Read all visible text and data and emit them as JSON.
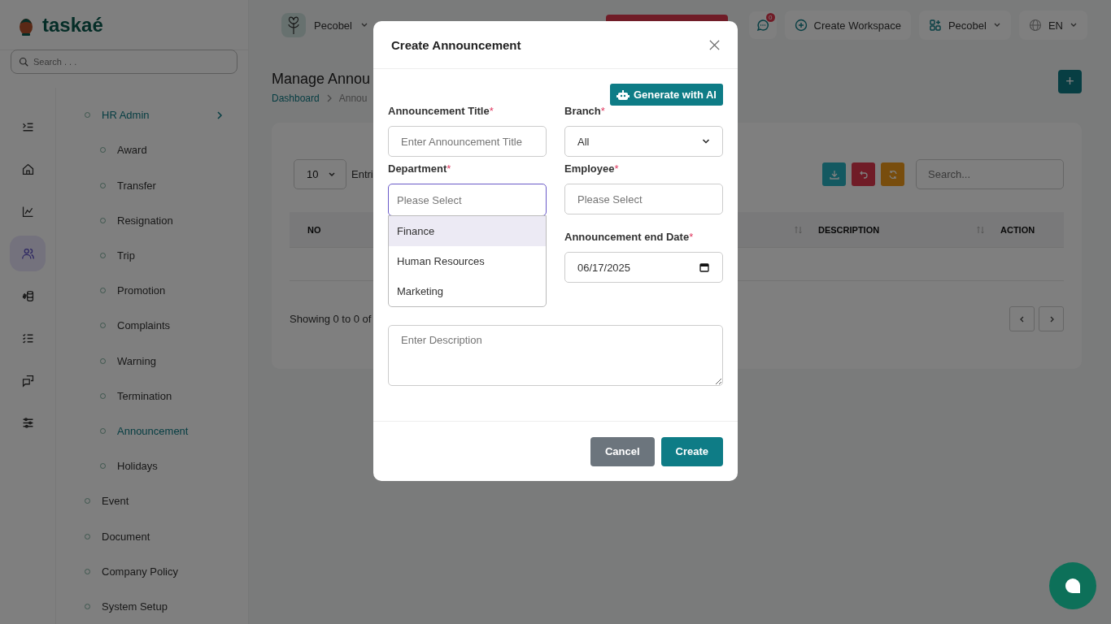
{
  "brand": {
    "name": "taskaé"
  },
  "sidebar": {
    "search": {
      "placeholder": "Search . . ."
    },
    "rail": [
      {
        "kind": "indent",
        "selected": false
      },
      {
        "kind": "home",
        "selected": false
      },
      {
        "kind": "chart",
        "selected": false
      },
      {
        "kind": "users",
        "selected": true
      },
      {
        "kind": "money",
        "selected": false
      },
      {
        "kind": "checklist",
        "selected": false
      },
      {
        "kind": "chat",
        "selected": false
      },
      {
        "kind": "sliders",
        "selected": false
      }
    ],
    "menu": [
      {
        "label": "HR Admin",
        "selected": true,
        "children": [
          {
            "label": "Award",
            "selected": false
          },
          {
            "label": "Transfer",
            "selected": false
          },
          {
            "label": "Resignation",
            "selected": false
          },
          {
            "label": "Trip",
            "selected": false
          },
          {
            "label": "Promotion",
            "selected": false
          },
          {
            "label": "Complaints",
            "selected": false
          },
          {
            "label": "Warning",
            "selected": false
          },
          {
            "label": "Termination",
            "selected": false
          },
          {
            "label": "Announcement",
            "selected": true
          },
          {
            "label": "Holidays",
            "selected": false
          }
        ]
      },
      {
        "label": "Event",
        "selected": false
      },
      {
        "label": "Document",
        "selected": false
      },
      {
        "label": "Company Policy",
        "selected": false
      },
      {
        "label": "System Setup",
        "selected": false
      }
    ]
  },
  "topbar": {
    "workspace": "Pecobel",
    "messages_badge": "0",
    "create_workspace": "Create Workspace",
    "company": "Pecobel",
    "language": "EN"
  },
  "page": {
    "title": "Manage Annou",
    "breadcrumb": [
      "Dashboard",
      "Annou"
    ],
    "add_button": "+",
    "entries": {
      "value": "10",
      "label": "Entri"
    },
    "search": {
      "placeholder": "Search..."
    },
    "columns": [
      {
        "label": "NO"
      },
      {
        "label": "DESCRIPTION"
      },
      {
        "label": "ACTION"
      }
    ],
    "showing": "Showing 0 to 0 of"
  },
  "modal": {
    "title": "Create Announcement",
    "ai_button": "Generate with AI",
    "fields": [
      {
        "kind": "text",
        "label": "Announcement Title",
        "mark": "*",
        "placeholder": "Enter Announcement Title"
      },
      {
        "kind": "select",
        "label": "Branch",
        "mark": "*",
        "value": "All"
      },
      {
        "kind": "dropdown",
        "label": "Department",
        "mark": "*",
        "placeholder": "Please Select",
        "open": true,
        "options": [
          {
            "label": "Finance",
            "selected": true
          },
          {
            "label": "Human Resources",
            "selected": false
          },
          {
            "label": "Marketing",
            "selected": false
          }
        ]
      },
      {
        "kind": "text",
        "label": "Employee",
        "mark": "*",
        "placeholder": "Please Select"
      },
      {
        "kind": "blank"
      },
      {
        "kind": "date",
        "label": "Announcement end Date",
        "mark": "*",
        "value": "06/17/2025"
      },
      {
        "kind": "textarea",
        "placeholder": "Enter Description"
      }
    ],
    "buttons": [
      {
        "label": "Cancel",
        "kind": "secondary"
      },
      {
        "label": "Create",
        "kind": "primary"
      }
    ]
  }
}
